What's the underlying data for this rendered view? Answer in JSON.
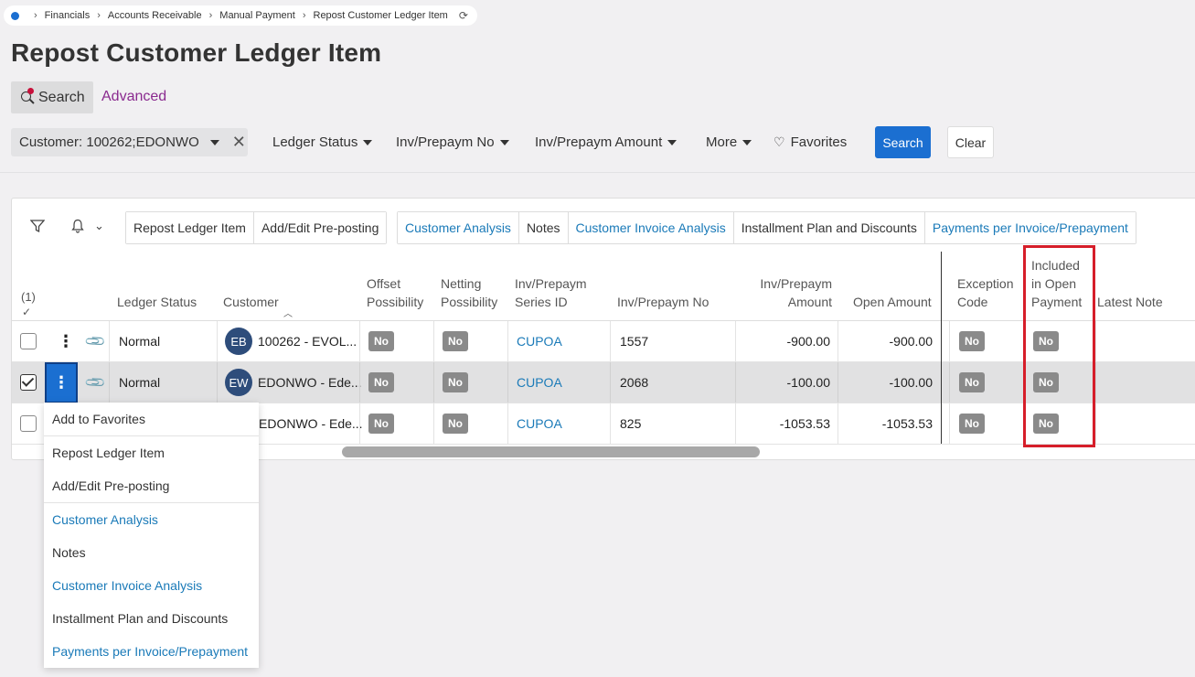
{
  "breadcrumb": {
    "items": [
      "Financials",
      "Accounts Receivable",
      "Manual Payment",
      "Repost Customer Ledger Item"
    ]
  },
  "page": {
    "title": "Repost Customer Ledger Item"
  },
  "search_tabs": {
    "search": "Search",
    "advanced": "Advanced"
  },
  "filters": {
    "customer_chip": "Customer: 100262;EDONWO",
    "ledger_status": "Ledger Status",
    "inv_no": "Inv/Prepaym No",
    "inv_amount": "Inv/Prepaym Amount",
    "more": "More",
    "favorites": "Favorites",
    "search_button": "Search",
    "clear_button": "Clear"
  },
  "toolbar": {
    "group1": [
      "Repost Ledger Item",
      "Add/Edit Pre-posting"
    ],
    "group2": [
      "Customer Analysis",
      "Notes",
      "Customer Invoice Analysis",
      "Installment Plan and Discounts",
      "Payments per Invoice/Prepayment"
    ]
  },
  "grid": {
    "selection_count": "(1)",
    "selection_mark": "✓",
    "columns": {
      "ledger_status": "Ledger Status",
      "customer": "Customer",
      "offset_1": "Offset",
      "offset_2": "Possibility",
      "netting_1": "Netting",
      "netting_2": "Possibility",
      "series_1": "Inv/Prepaym",
      "series_2": "Series ID",
      "inv_no": "Inv/Prepaym No",
      "amount_1": "Inv/Prepaym",
      "amount_2": "Amount",
      "open_amount": "Open Amount",
      "exception_1": "Exception",
      "exception_2": "Code",
      "included_1": "Included",
      "included_2": "in Open",
      "included_3": "Payment",
      "latest_note": "Latest Note"
    },
    "rows": [
      {
        "status": "Normal",
        "initials": "EB",
        "customer": "100262 - EVOL...",
        "offset": "No",
        "netting": "No",
        "series": "CUPOA",
        "inv_no": "1557",
        "amount": "-900.00",
        "open": "-900.00",
        "exception": "No",
        "included": "No"
      },
      {
        "status": "Normal",
        "initials": "EW",
        "customer": "EDONWO - Ede...",
        "offset": "No",
        "netting": "No",
        "series": "CUPOA",
        "inv_no": "2068",
        "amount": "-100.00",
        "open": "-100.00",
        "exception": "No",
        "included": "No"
      },
      {
        "status": "",
        "initials": "",
        "customer": "EDONWO - Ede...",
        "offset": "No",
        "netting": "No",
        "series": "CUPOA",
        "inv_no": "825",
        "amount": "-1053.53",
        "open": "-1053.53",
        "exception": "No",
        "included": "No"
      }
    ]
  },
  "context_menu": {
    "items": [
      "Add to Favorites",
      "Repost Ledger Item",
      "Add/Edit Pre-posting",
      "Customer Analysis",
      "Notes",
      "Customer Invoice Analysis",
      "Installment Plan and Discounts",
      "Payments per Invoice/Prepayment"
    ]
  },
  "colors": {
    "primary": "#1b6fd1",
    "link": "#1a7ab8",
    "advanced": "#8a2a8f",
    "highlight": "#d61e2a",
    "badge": "#8a8a8a",
    "avatar": "#2e4d7b"
  }
}
